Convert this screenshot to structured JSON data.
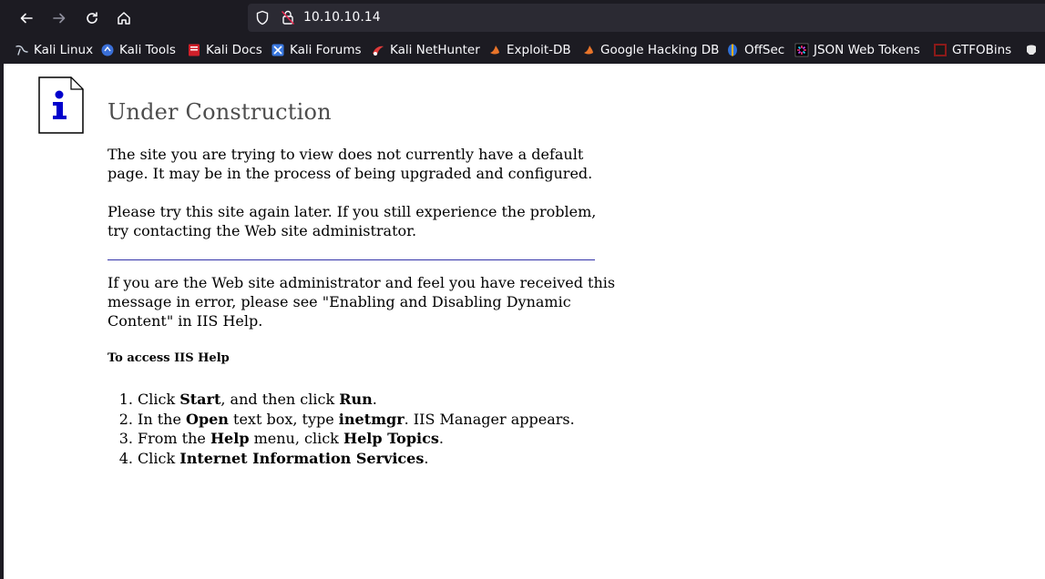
{
  "browser": {
    "url": "10.10.10.14",
    "bookmarks": [
      {
        "label": "Kali Linux",
        "icon": "kali-dragon-icon"
      },
      {
        "label": "Kali Tools",
        "icon": "kali-tools-icon"
      },
      {
        "label": "Kali Docs",
        "icon": "kali-docs-icon"
      },
      {
        "label": "Kali Forums",
        "icon": "kali-forums-icon"
      },
      {
        "label": "Kali NetHunter",
        "icon": "nethunter-icon"
      },
      {
        "label": "Exploit-DB",
        "icon": "exploit-db-icon"
      },
      {
        "label": "Google Hacking DB",
        "icon": "ghdb-icon"
      },
      {
        "label": "OffSec",
        "icon": "offsec-icon"
      },
      {
        "label": "JSON Web Tokens",
        "icon": "jwt-icon"
      },
      {
        "label": "GTFOBins",
        "icon": "gtfobins-icon"
      }
    ]
  },
  "page": {
    "title": "Under Construction",
    "para1": "The site you are trying to view does not currently have a default page. It may be in the process of being upgraded and configured.",
    "para2": "Please try this site again later. If you still experience the problem, try contacting the Web site administrator.",
    "para3": "If you are the Web site administrator and feel you have received this message in error, please see \"Enabling and Disabling Dynamic Content\" in IIS Help.",
    "help_heading": "To access IIS Help",
    "steps": [
      {
        "num": "1.",
        "parts": [
          "Click ",
          "Start",
          ", and then click ",
          "Run",
          "."
        ]
      },
      {
        "num": "2.",
        "parts": [
          "In the ",
          "Open",
          " text box, type ",
          "inetmgr",
          ". IIS Manager appears."
        ]
      },
      {
        "num": "3.",
        "parts": [
          "From the ",
          "Help",
          " menu, click ",
          "Help Topics",
          "."
        ]
      },
      {
        "num": "4.",
        "parts": [
          "Click ",
          "Internet Information Services",
          "."
        ]
      }
    ]
  },
  "colors": {
    "chrome_bg": "#1c1b22",
    "urlbar_bg": "#2b2a33",
    "rule": "#3333aa",
    "info_icon": "#0000cc"
  }
}
